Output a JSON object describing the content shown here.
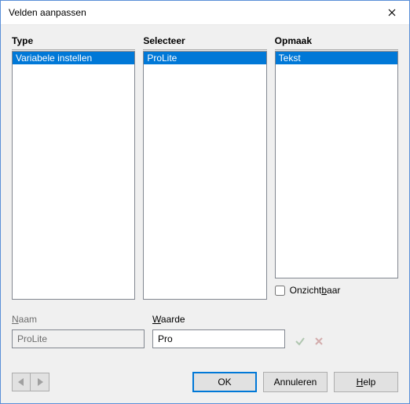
{
  "window": {
    "title": "Velden aanpassen"
  },
  "columns": {
    "type": {
      "header": "Type",
      "items": [
        "Variabele instellen"
      ],
      "selected": 0
    },
    "select": {
      "header": "Selecteer",
      "items": [
        "ProLite"
      ],
      "selected": 0
    },
    "format": {
      "header": "Opmaak",
      "items": [
        "Tekst"
      ],
      "selected": 0
    }
  },
  "invisible": {
    "label_pre": "Onzicht",
    "label_hot": "b",
    "label_post": "aar",
    "checked": false
  },
  "name": {
    "label_hot": "N",
    "label_rest": "aam",
    "value": "ProLite",
    "enabled": false
  },
  "value": {
    "label_hot": "W",
    "label_rest": "aarde",
    "value": "Pro"
  },
  "buttons": {
    "ok": "OK",
    "cancel": "Annuleren",
    "help_hot": "H",
    "help_rest": "elp"
  }
}
